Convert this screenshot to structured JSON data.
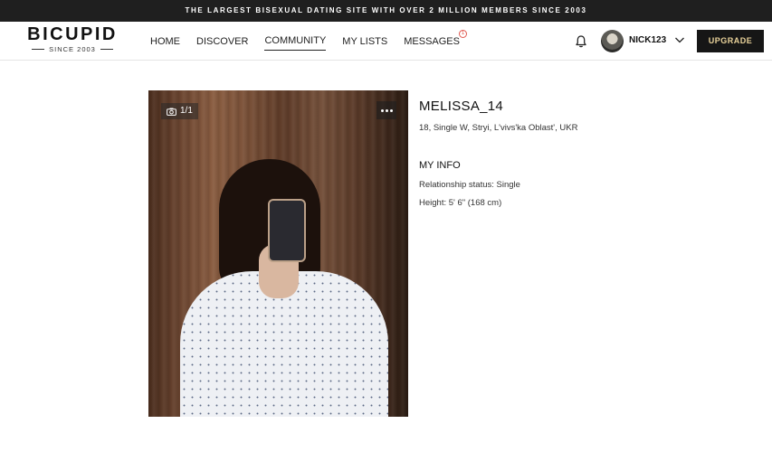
{
  "banner": {
    "text": "THE LARGEST BISEXUAL DATING SITE WITH OVER 2 MILLION MEMBERS SINCE 2003"
  },
  "logo": {
    "name": "BICUPID",
    "tagline": "SINCE 2003"
  },
  "nav": {
    "items": [
      {
        "label": "HOME"
      },
      {
        "label": "DISCOVER"
      },
      {
        "label": "COMMUNITY",
        "active": true
      },
      {
        "label": "MY LISTS"
      },
      {
        "label": "MESSAGES",
        "badge": "1"
      }
    ]
  },
  "user": {
    "username": "NICK123",
    "notification_icon": "bell-icon",
    "menu_icon": "chevron-down-icon"
  },
  "upgrade": {
    "label": "UPGRADE",
    "color": "#e9d29a",
    "background": "#161616"
  },
  "photo": {
    "counter": "1/1",
    "camera_icon": "camera-icon",
    "more_icon": "more-horizontal-icon"
  },
  "profile": {
    "name": "MELISSA_14",
    "details": "18, Single W, Stryi, L'vivs'ka Oblast', UKR",
    "info_title": "MY INFO",
    "relationship": "Relationship status: Single",
    "height": "Height: 5' 6\" (168 cm)"
  },
  "colors": {
    "topbar": "#1f1f1f",
    "badge": "#e0584f",
    "accent": "#e9d29a"
  }
}
